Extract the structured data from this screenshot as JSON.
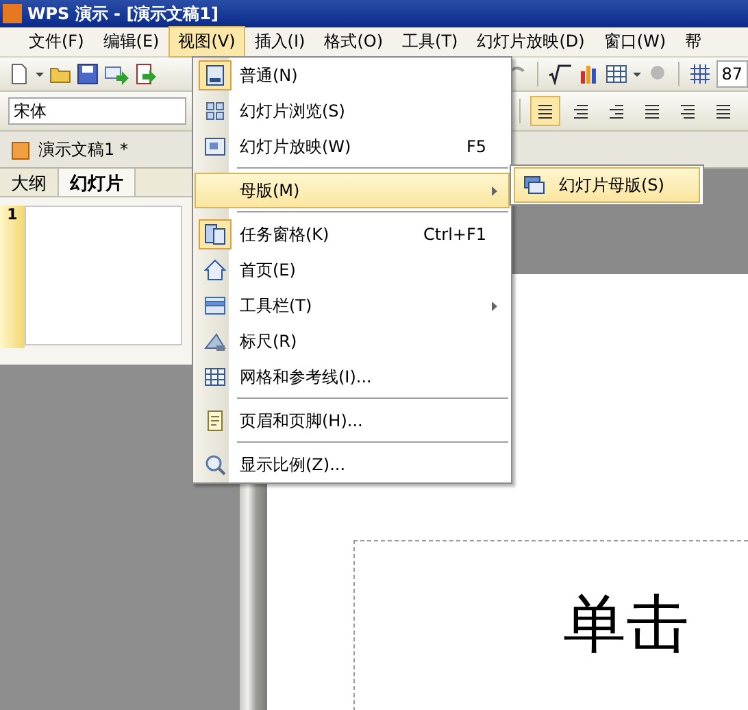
{
  "window": {
    "title": "WPS 演示 - [演示文稿1]"
  },
  "menubar": [
    {
      "label": "文件(F)",
      "selected": false
    },
    {
      "label": "编辑(E)",
      "selected": false
    },
    {
      "label": "视图(V)",
      "selected": true
    },
    {
      "label": "插入(I)",
      "selected": false
    },
    {
      "label": "格式(O)",
      "selected": false
    },
    {
      "label": "工具(T)",
      "selected": false
    },
    {
      "label": "幻灯片放映(D)",
      "selected": false
    },
    {
      "label": "窗口(W)",
      "selected": false
    },
    {
      "label": "帮",
      "selected": false
    }
  ],
  "toolbar": {
    "zoom_value": "87"
  },
  "format_bar": {
    "font": "宋体",
    "align_buttons": [
      {
        "selected": true
      },
      {
        "selected": false
      },
      {
        "selected": false
      },
      {
        "selected": false
      },
      {
        "selected": false
      },
      {
        "selected": false
      }
    ]
  },
  "document_tab": {
    "label": "演示文稿1 *"
  },
  "left_pane": {
    "tabs": [
      {
        "label": "大纲",
        "selected": false
      },
      {
        "label": "幻灯片",
        "selected": true
      }
    ],
    "slides": [
      {
        "number": "1",
        "selected": true
      }
    ]
  },
  "slide": {
    "title_placeholder": "单击"
  },
  "view_menu": [
    {
      "kind": "item",
      "label": "普通(N)",
      "checked": true,
      "selected": false
    },
    {
      "kind": "item",
      "label": "幻灯片浏览(S)",
      "checked": false,
      "selected": false
    },
    {
      "kind": "item",
      "label": "幻灯片放映(W)",
      "shortcut": "F5",
      "checked": false,
      "selected": false
    },
    {
      "kind": "separator"
    },
    {
      "kind": "submenu",
      "label": "母版(M)",
      "checked": false,
      "selected": true
    },
    {
      "kind": "separator"
    },
    {
      "kind": "item",
      "label": "任务窗格(K)",
      "shortcut": "Ctrl+F1",
      "checked": true,
      "selected": false
    },
    {
      "kind": "item",
      "label": "首页(E)",
      "checked": false,
      "selected": false
    },
    {
      "kind": "submenu",
      "label": "工具栏(T)",
      "checked": false,
      "selected": false
    },
    {
      "kind": "item",
      "label": "标尺(R)",
      "checked": false,
      "selected": false
    },
    {
      "kind": "item",
      "label": "网格和参考线(I)...",
      "checked": false,
      "selected": false
    },
    {
      "kind": "separator"
    },
    {
      "kind": "item",
      "label": "页眉和页脚(H)...",
      "checked": false,
      "selected": false
    },
    {
      "kind": "separator"
    },
    {
      "kind": "item",
      "label": "显示比例(Z)...",
      "checked": false,
      "selected": false
    }
  ],
  "master_submenu": [
    {
      "label": "幻灯片母版(S)",
      "selected": true
    }
  ]
}
